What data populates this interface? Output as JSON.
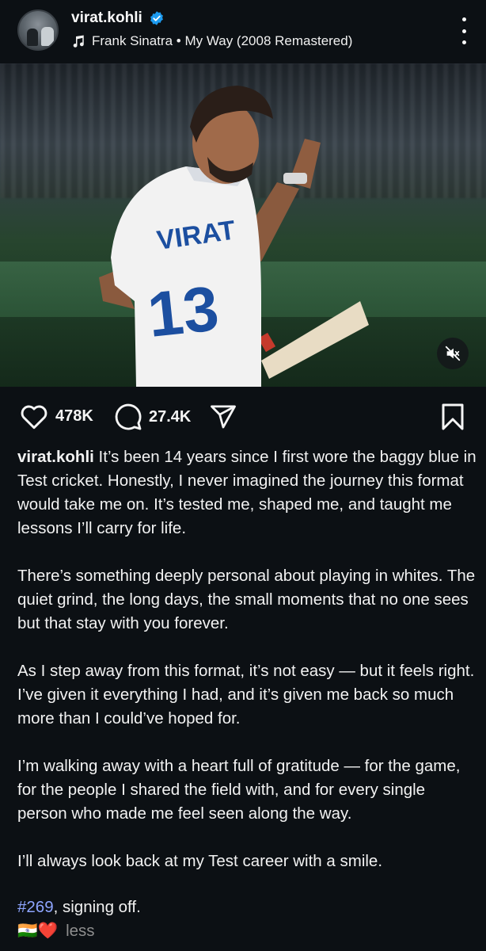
{
  "header": {
    "username": "virat.kohli",
    "verified_icon": "verified-badge-icon",
    "music_icon": "music-note-icon",
    "music_text": "Frank Sinatra • My Way (2008 Remastered)",
    "menu_icon": "more-options-icon"
  },
  "media": {
    "mute_icon": "sound-off-icon"
  },
  "actions": {
    "likes": "478K",
    "comments": "27.4K",
    "like_icon": "heart-icon",
    "comment_icon": "comment-icon",
    "share_icon": "share-icon",
    "save_icon": "bookmark-icon"
  },
  "caption": {
    "username": "virat.kohli",
    "p1": "It’s been 14 years since I first wore the baggy blue in Test cricket. Honestly, I never imagined the journey this format would take me on. It’s tested me, shaped me, and taught me lessons I’ll carry for life.",
    "p2": "There’s something deeply personal about playing in whites. The quiet grind, the long days, the small moments that no one sees but that stay with you forever.",
    "p3": "As I step away from this format, it’s not easy — but it feels right. I’ve given it everything I had, and it’s given me back so much more than I could’ve hoped for.",
    "p4": "I’m walking away with a heart full of gratitude — for the game, for the people I shared the field with, and for every single person who made me feel seen along the way.",
    "p5": "I’ll always look back at my Test career with a smile.",
    "hashtag": "#269",
    "signoff": ", signing off.",
    "emoji": "🇮🇳❤️",
    "less": "less"
  },
  "colors": {
    "background": "#0c1014",
    "hashtag": "#8ea5ff",
    "verified": "#1d9bf0",
    "muted_text": "#8e8e8e"
  }
}
